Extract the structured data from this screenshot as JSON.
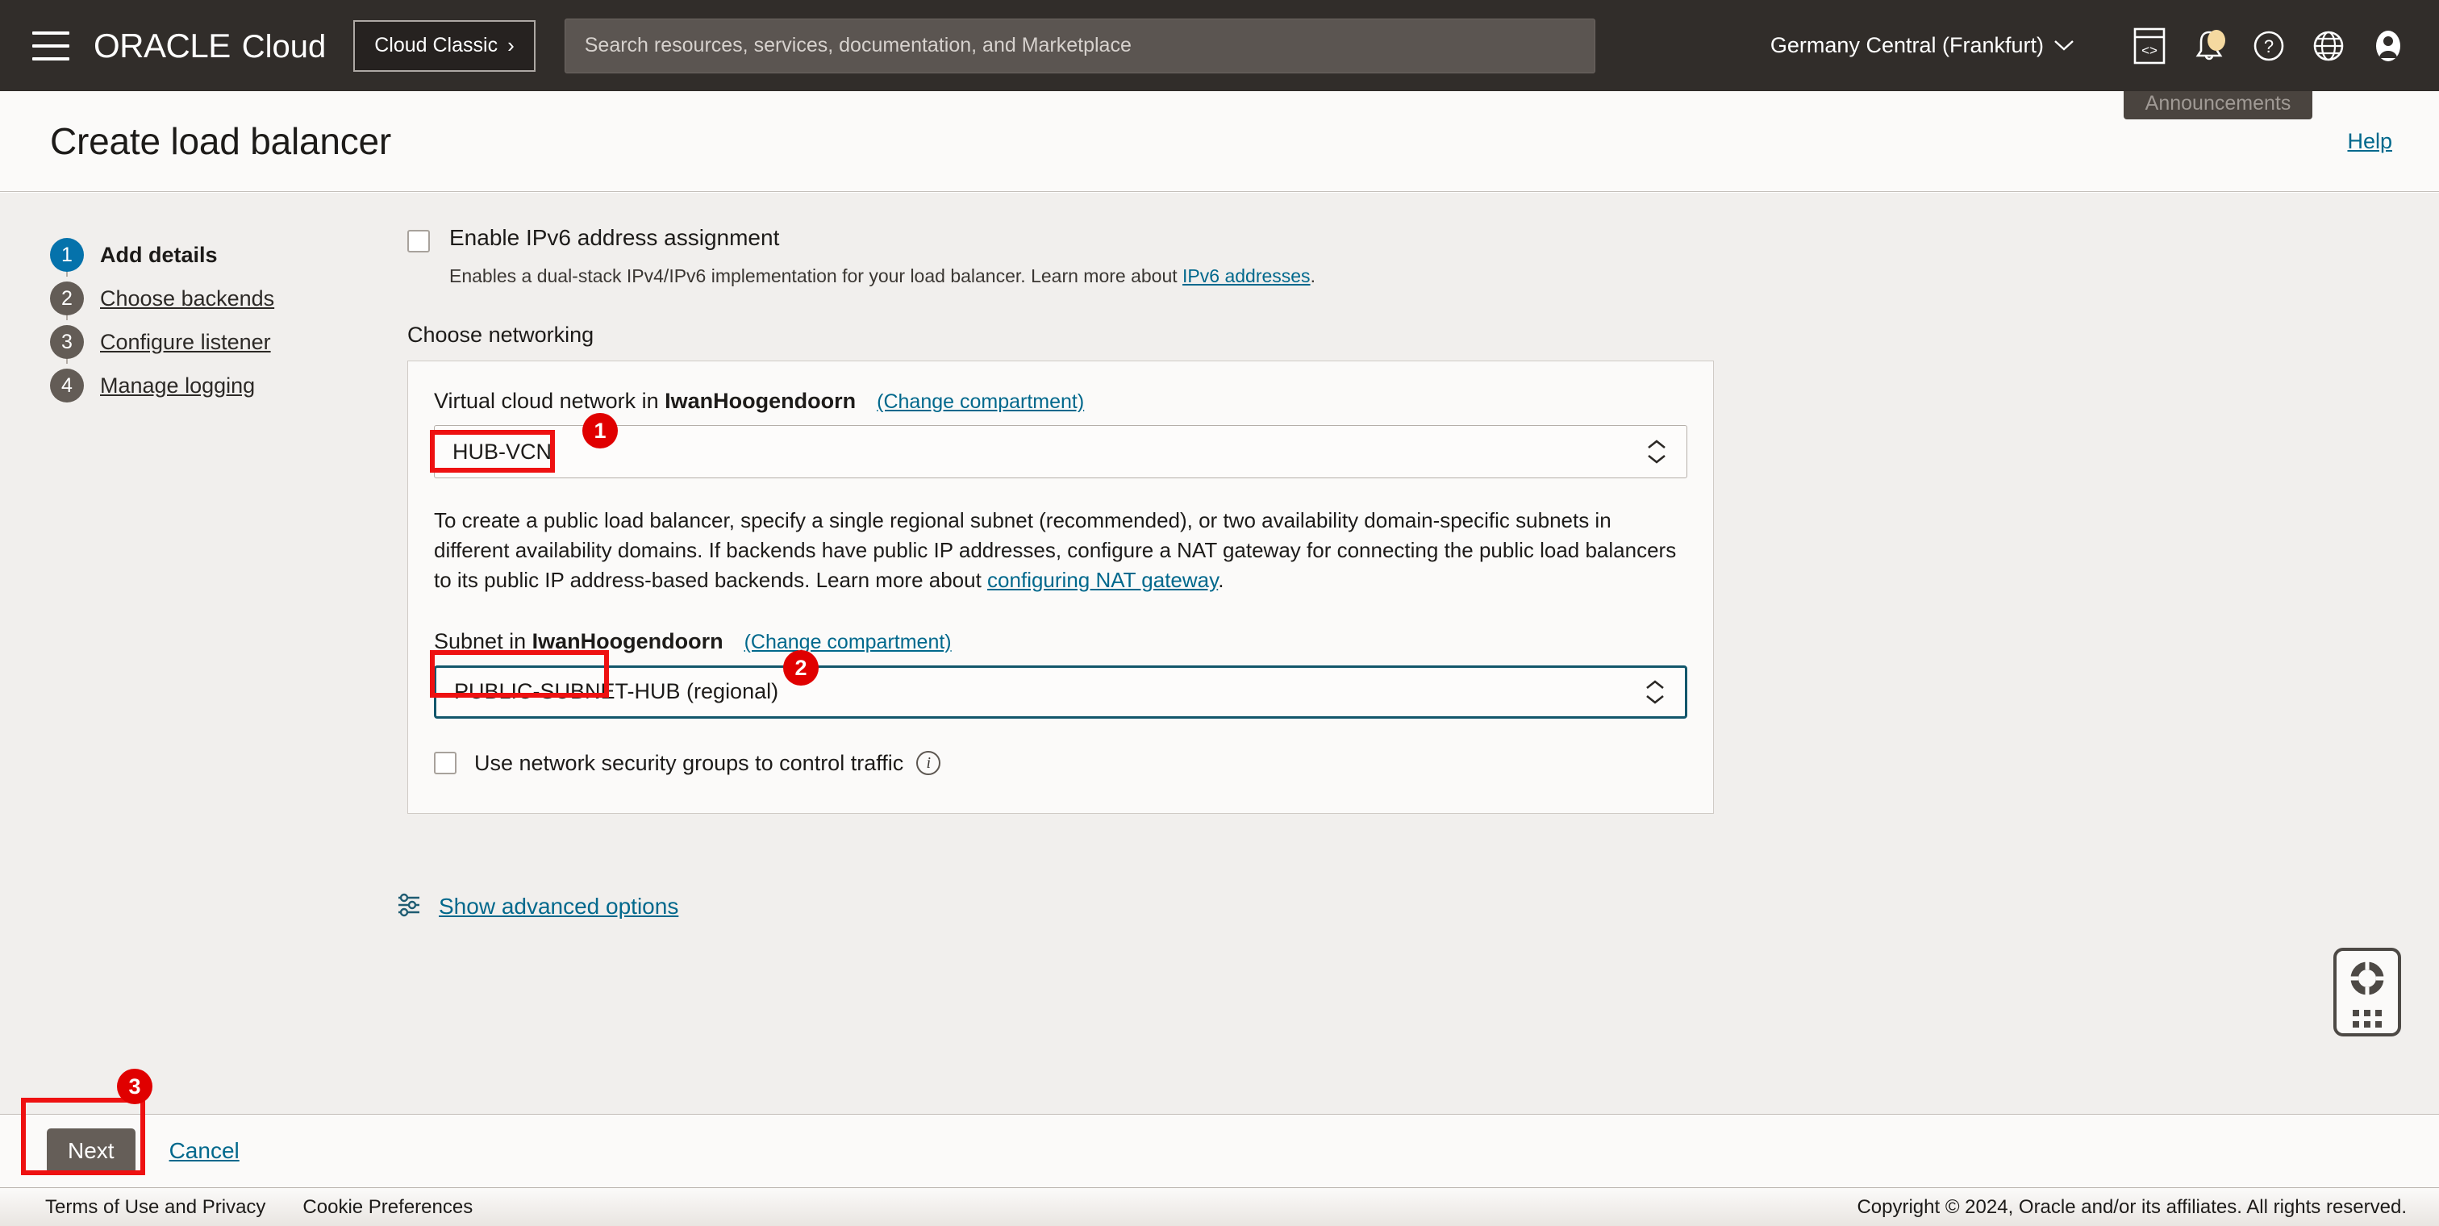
{
  "topnav": {
    "logo_oracle": "ORACLE",
    "logo_cloud": "Cloud",
    "cloud_classic_label": "Cloud Classic",
    "cloud_classic_chevron": "›",
    "search_placeholder": "Search resources, services, documentation, and Marketplace",
    "search_value": "",
    "region": "Germany Central (Frankfurt)",
    "region_chevron": "∨",
    "icons": [
      "code-editor-icon",
      "notifications-bell-icon",
      "help-question-icon",
      "language-globe-icon",
      "user-avatar-icon"
    ],
    "tooltip": "Announcements"
  },
  "page_header": {
    "title": "Create load balancer",
    "help_label": "Help"
  },
  "steps": [
    {
      "number": "1",
      "label": "Add details",
      "state": "active"
    },
    {
      "number": "2",
      "label": "Choose backends",
      "state": "idle"
    },
    {
      "number": "3",
      "label": "Configure listener",
      "state": "idle"
    },
    {
      "number": "4",
      "label": "Manage logging",
      "state": "idle"
    }
  ],
  "form": {
    "ipv6": {
      "label": "Enable IPv6 address assignment",
      "checked": false,
      "help_prefix": "Enables a dual-stack IPv4/IPv6 implementation for your load balancer. Learn more about ",
      "help_link": "IPv6 addresses",
      "help_suffix": "."
    },
    "section_label": "Choose networking",
    "vcn": {
      "label_prefix": "Virtual cloud network in ",
      "compartment": "IwanHoogendoorn",
      "change_compartment": "(Change compartment)",
      "value": "HUB-VCN"
    },
    "paragraph": "To create a public load balancer, specify a single regional subnet (recommended), or two availability domain-specific subnets in different availability domains. If backends have public IP addresses, configure a NAT gateway for connecting the public load balancers to its public IP address-based backends. Learn more about ",
    "paragraph_link": "configuring NAT gateway",
    "paragraph_suffix": ".",
    "subnet": {
      "label_prefix": "Subnet in ",
      "compartment": "IwanHoogendoorn",
      "change_compartment": "(Change compartment)",
      "value": "PUBLIC-SUBNET-HUB (regional)",
      "focused": true
    },
    "nsg": {
      "label": "Use network security groups to control traffic",
      "checked": false,
      "info_icon": "info-icon"
    },
    "advanced": {
      "icon": "sliders-icon",
      "label": "Show advanced options"
    }
  },
  "action_bar": {
    "next_label": "Next",
    "cancel_label": "Cancel"
  },
  "footer": {
    "terms": "Terms of Use and Privacy",
    "cookies": "Cookie Preferences",
    "copyright": "Copyright © 2024, Oracle and/or its affiliates. All rights reserved."
  },
  "support_widget": {
    "icon": "life-preserver-icon"
  },
  "annotations": [
    {
      "number": "1",
      "target": "vcn-select"
    },
    {
      "number": "2",
      "target": "subnet-select"
    },
    {
      "number": "3",
      "target": "next-button"
    }
  ],
  "colors": {
    "nav_bg": "#312d2a",
    "accent_link": "#00688c",
    "step_active": "#0572ab",
    "step_idle": "#635c56",
    "annotation_red": "#ee1111",
    "focus_border": "#12566b",
    "button_grey": "#655e58"
  }
}
